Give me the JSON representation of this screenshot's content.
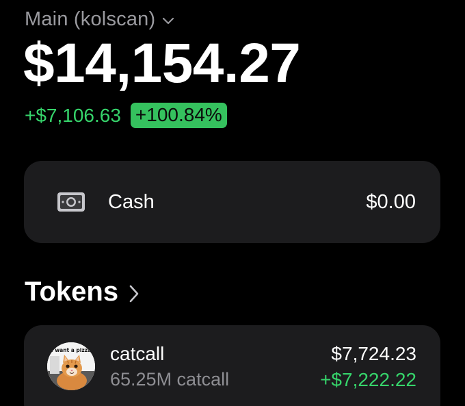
{
  "account": {
    "name": "Main (kolscan)",
    "switch_icon": "chevron-down-icon"
  },
  "portfolio": {
    "balance": "$14,154.27",
    "change_amount": "+$7,106.63",
    "change_percent": "+100.84%"
  },
  "cash": {
    "icon": "banknote-icon",
    "label": "Cash",
    "value": "$0.00"
  },
  "tokens": {
    "title": "Tokens",
    "header_icon": "chevron-right-icon",
    "items": [
      {
        "avatar_caption": "I want a pizza",
        "name": "catcall",
        "amount": "65.25M catcall",
        "value": "$7,724.23",
        "change": "+$7,222.22"
      }
    ]
  },
  "colors": {
    "background": "#000000",
    "card": "#1c1c1e",
    "positive": "#36d46b",
    "positive_badge": "#35c15e",
    "muted_text": "#8e8e93"
  }
}
